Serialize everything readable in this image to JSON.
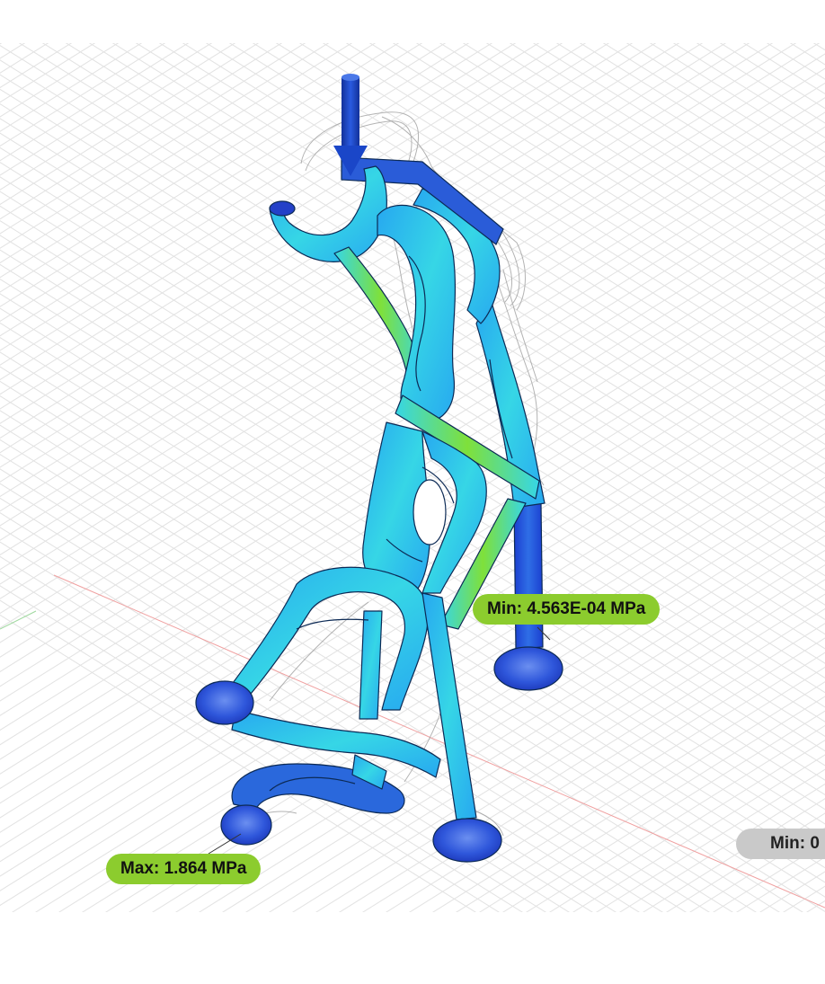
{
  "viewport": {
    "background_color": "#ffffff",
    "grid_color": "#e3e3e3",
    "x_axis_color": "#f0a0a0",
    "y_axis_color": "#9ed89e",
    "load_arrow_color": "#1a46c8",
    "stress_legend_colors": [
      "#1b3fd0",
      "#27a8f0",
      "#36d6e6",
      "#7fe03a"
    ]
  },
  "model": {
    "name": "",
    "load_icon": "downward-arrow-icon"
  },
  "probes": {
    "min": {
      "label": "Min: 4.563E-04 MPa",
      "color": "#8ccc2e"
    },
    "max": {
      "label": "Max: 1.864 MPa",
      "color": "#8ccc2e"
    },
    "min_secondary": {
      "label": "Min: 0",
      "color": "#c9c9c9"
    }
  }
}
